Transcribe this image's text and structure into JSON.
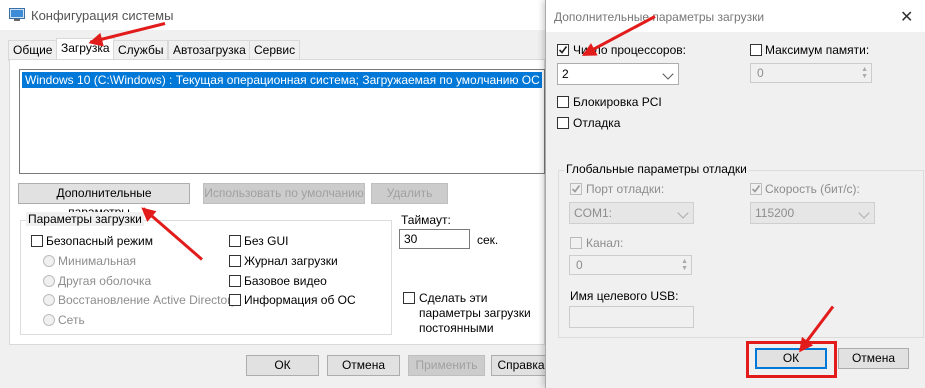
{
  "main_window": {
    "title": "Конфигурация системы",
    "tabs": [
      "Общие",
      "Загрузка",
      "Службы",
      "Автозагрузка",
      "Сервис"
    ],
    "active_tab": "Загрузка",
    "os_list": [
      "Windows 10 (C:\\Windows) : Текущая операционная система; Загружаемая по умолчанию ОС"
    ],
    "buttons": {
      "advanced": "Дополнительные параметры...",
      "set_default": "Использовать по умолчанию",
      "delete": "Удалить"
    },
    "boot_options": {
      "title": "Параметры загрузки",
      "safe_boot": "Безопасный режим",
      "minimal": "Минимальная",
      "alternate_shell": "Другая оболочка",
      "ad_repair": "Восстановление Active Directory",
      "network": "Сеть",
      "no_gui": "Без GUI",
      "boot_log": "Журнал загрузки",
      "base_video": "Базовое видео",
      "os_boot_info": "Информация  об ОС"
    },
    "timeout": {
      "label": "Таймаут:",
      "value": "30",
      "unit": "сек."
    },
    "make_permanent": "Сделать эти параметры загрузки постоянными",
    "footer": {
      "ok": "ОК",
      "cancel": "Отмена",
      "apply": "Применить",
      "help": "Справка"
    }
  },
  "advanced_dialog": {
    "title": "Дополнительные параметры загрузки",
    "close_glyph": "✕",
    "num_processors": {
      "label": "Число процессоров:",
      "checked": true,
      "value": "2"
    },
    "max_memory": {
      "label": "Максимум памяти:",
      "checked": false,
      "value": "0"
    },
    "pci_lock": {
      "label": "Блокировка PCI",
      "checked": false
    },
    "debug": {
      "label": "Отладка",
      "checked": false
    },
    "global_debug": {
      "title": "Глобальные параметры отладки",
      "debug_port": {
        "label": "Порт отладки:",
        "checked": true,
        "value": "COM1:"
      },
      "baud_rate": {
        "label": "Скорость (бит/с):",
        "checked": true,
        "value": "115200"
      },
      "channel": {
        "label": "Канал:",
        "checked": false,
        "value": "0"
      },
      "usb_target": {
        "label": "Имя целевого USB:",
        "value": ""
      }
    },
    "ok": "ОК",
    "cancel": "Отмена"
  },
  "colors": {
    "selection": "#0078d7",
    "annotation": "#e21b1b",
    "window_bg": "#f0f0f0"
  }
}
